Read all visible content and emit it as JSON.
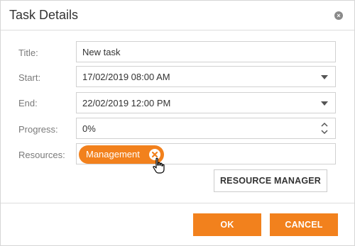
{
  "dialog": {
    "title": "Task Details",
    "close_icon": "close-icon"
  },
  "form": {
    "title": {
      "label": "Title:",
      "value": "New task"
    },
    "start": {
      "label": "Start:",
      "value": "17/02/2019 08:00 AM"
    },
    "end": {
      "label": "End:",
      "value": "22/02/2019 12:00 PM"
    },
    "progress": {
      "label": "Progress:",
      "value": "0%"
    },
    "resources": {
      "label": "Resources:",
      "tags": [
        {
          "label": "Management"
        }
      ]
    }
  },
  "buttons": {
    "resource_manager": "RESOURCE MANAGER",
    "ok": "OK",
    "cancel": "CANCEL"
  },
  "colors": {
    "accent": "#f2811d",
    "border": "#d1d1d1",
    "label": "#7a7a7a"
  },
  "icons": {
    "dropdown": "chevron-down-icon",
    "spinner": "spin-up-down-icon",
    "tag_remove": "remove-tag-icon",
    "cursor": "hand-pointer-icon"
  }
}
